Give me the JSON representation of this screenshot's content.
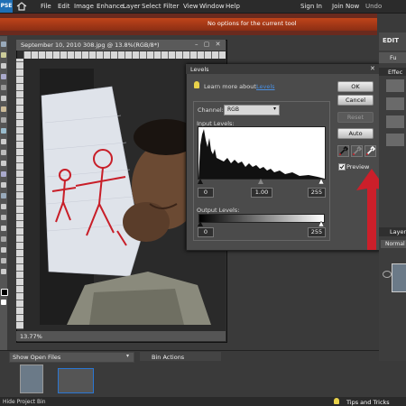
{
  "menubar": {
    "logo": "PSE",
    "items": [
      "File",
      "Edit",
      "Image",
      "Enhance",
      "Layer",
      "Select",
      "Filter",
      "View",
      "Window",
      "Help"
    ],
    "sign_in": "Sign In",
    "join_now": "Join Now",
    "undo": "Undo"
  },
  "options_bar": {
    "message": "No options for the current tool"
  },
  "edit_tab": "EDIT",
  "document": {
    "title": "September 10, 2010 308.jpg @ 13.8%(RGB/8*)",
    "window_controls": "– ▢ ✕",
    "zoom": "13.77%"
  },
  "levels_dialog": {
    "title": "Levels",
    "close": "✕",
    "learn_more_prefix": "Learn more about:",
    "learn_more_link": "Levels",
    "channel_label": "Channel:",
    "channel_value": "RGB",
    "input_levels_label": "Input Levels:",
    "input_black": "0",
    "input_gamma": "1.00",
    "input_white": "255",
    "output_levels_label": "Output Levels:",
    "output_black": "0",
    "output_white": "255",
    "ok": "OK",
    "cancel": "Cancel",
    "reset": "Reset",
    "auto": "Auto",
    "preview_label": "Preview",
    "preview_checked": true
  },
  "right_panel": {
    "top_label": "Fu",
    "effects_label": "Effec",
    "layers_label": "Layer",
    "blend_mode": "Normal"
  },
  "project_bin": {
    "show_open_files": "Show Open Files",
    "bin_actions": "Bin Actions"
  },
  "bottom_bar": {
    "hide_bin": "Hide Project Bin",
    "tips": "Tips and Tricks"
  },
  "colors": {
    "options_bar": "#c0441a",
    "arrow": "#cc1f2a",
    "link": "#4a8fe0"
  }
}
